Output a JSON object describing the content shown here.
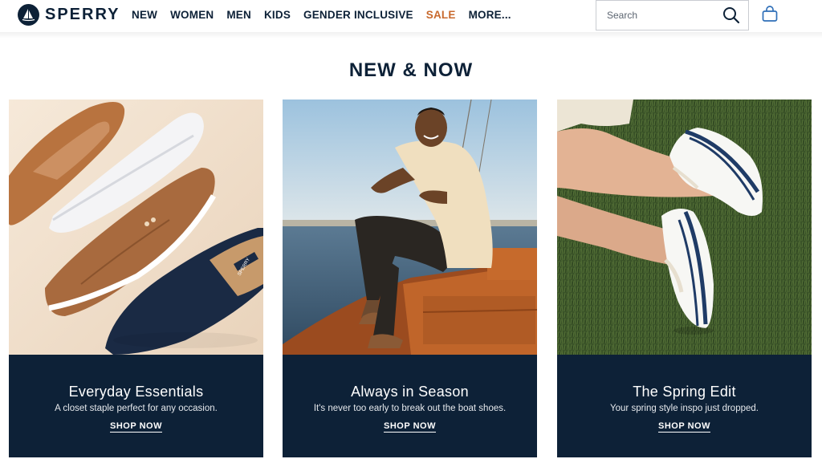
{
  "brand": {
    "name": "SPERRY"
  },
  "nav": {
    "items": [
      "NEW",
      "WOMEN",
      "MEN",
      "KIDS",
      "GENDER INCLUSIVE",
      "SALE",
      "MORE..."
    ]
  },
  "search": {
    "placeholder": "Search"
  },
  "icons": {
    "search": "search-icon",
    "bag": "shopping-bag-icon",
    "logo": "sailboat-icon"
  },
  "colors": {
    "navy": "#0d2137",
    "sale": "#c8692d"
  },
  "section": {
    "title": "NEW & NOW"
  },
  "cards": [
    {
      "title": "Everyday Essentials",
      "subtitle": "A closet staple perfect for any occasion.",
      "cta": "SHOP NOW"
    },
    {
      "title": "Always in Season",
      "subtitle": "It's never too early to break out the boat shoes.",
      "cta": "SHOP NOW"
    },
    {
      "title": "The Spring Edit",
      "subtitle": "Your spring style inspo just dropped.",
      "cta": "SHOP NOW"
    }
  ],
  "card_watermark": "SPERRY"
}
